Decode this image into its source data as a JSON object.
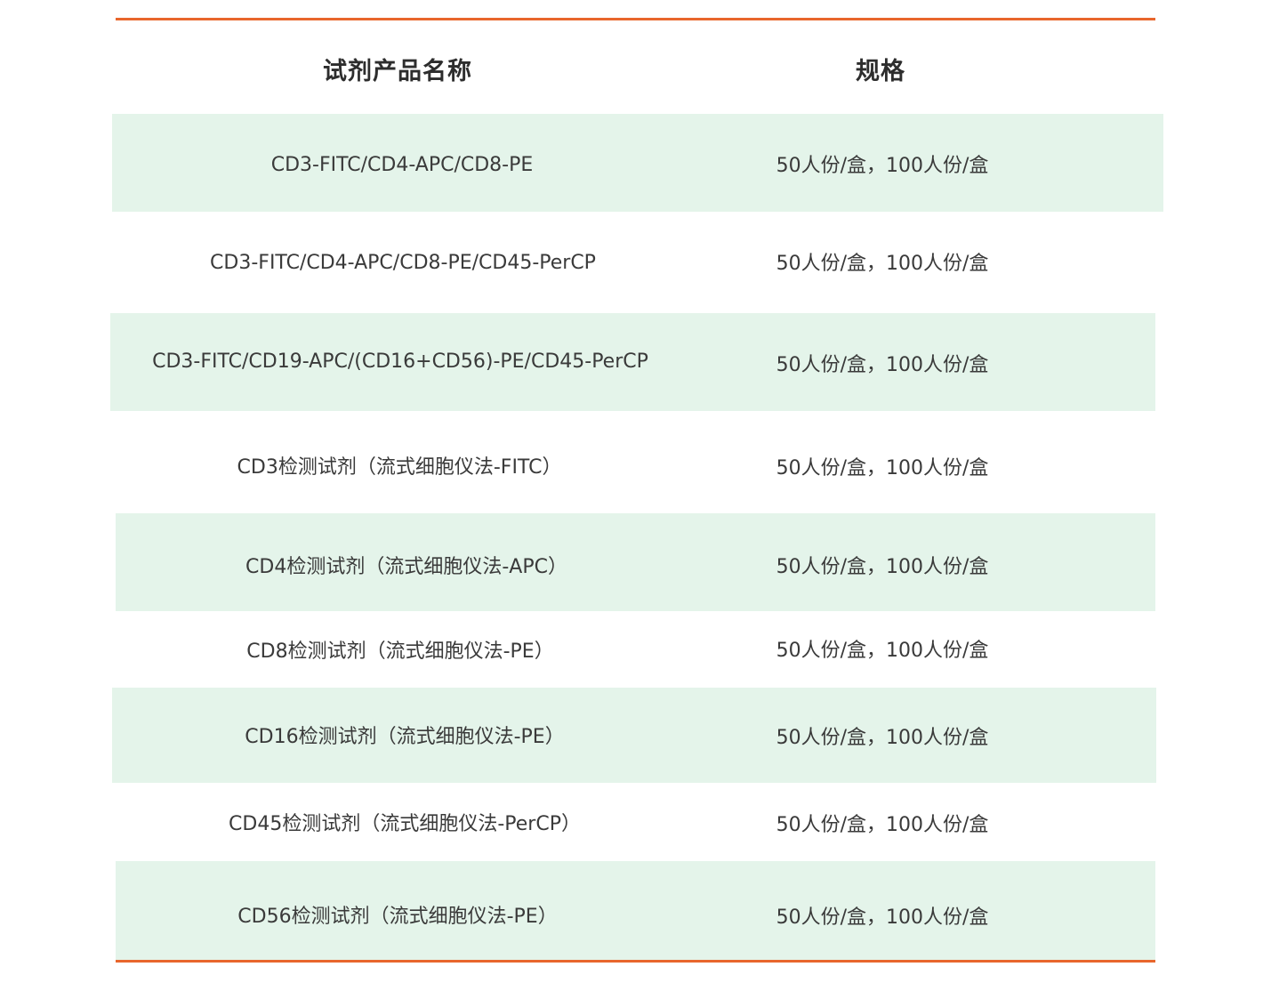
{
  "accent_color": "#e8662c",
  "stripe_color": "#e4f4ea",
  "header": {
    "name": "试剂产品名称",
    "spec": "规格"
  },
  "rows": [
    {
      "name": "CD3-FITC/CD4-APC/CD8-PE",
      "spec": "50人份/盒，100人份/盒"
    },
    {
      "name": "CD3-FITC/CD4-APC/CD8-PE/CD45-PerCP",
      "spec": "50人份/盒，100人份/盒"
    },
    {
      "name": "CD3-FITC/CD19-APC/(CD16+CD56)-PE/CD45-PerCP",
      "spec": "50人份/盒，100人份/盒"
    },
    {
      "name": "CD3检测试剂（流式细胞仪法-FITC）",
      "spec": "50人份/盒，100人份/盒"
    },
    {
      "name": "CD4检测试剂（流式细胞仪法-APC）",
      "spec": "50人份/盒，100人份/盒"
    },
    {
      "name": "CD8检测试剂（流式细胞仪法-PE）",
      "spec": "50人份/盒，100人份/盒"
    },
    {
      "name": "CD16检测试剂（流式细胞仪法-PE）",
      "spec": "50人份/盒，100人份/盒"
    },
    {
      "name": "CD45检测试剂（流式细胞仪法-PerCP）",
      "spec": "50人份/盒，100人份/盒"
    },
    {
      "name": "CD56检测试剂（流式细胞仪法-PE）",
      "spec": "50人份/盒，100人份/盒"
    }
  ]
}
